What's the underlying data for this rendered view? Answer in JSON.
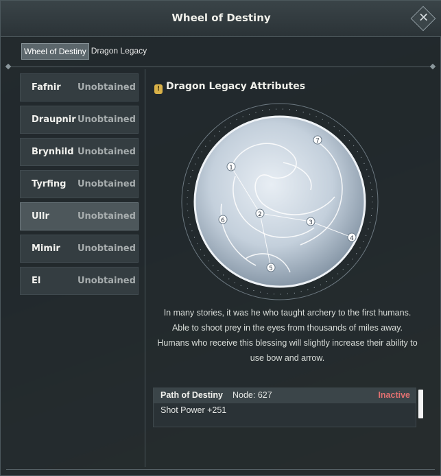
{
  "window": {
    "title": "Wheel of Destiny"
  },
  "tabs": [
    {
      "label": "Wheel of Destiny",
      "active": true
    },
    {
      "label": "Dragon Legacy",
      "active": false
    }
  ],
  "legacies": [
    {
      "name": "Fafnir",
      "status": "Unobtained",
      "selected": false
    },
    {
      "name": "Draupnir",
      "status": "Unobtained",
      "selected": false
    },
    {
      "name": "Brynhild",
      "status": "Unobtained",
      "selected": false
    },
    {
      "name": "Tyrfing",
      "status": "Unobtained",
      "selected": false
    },
    {
      "name": "Ullr",
      "status": "Unobtained",
      "selected": true
    },
    {
      "name": "Mimir",
      "status": "Unobtained",
      "selected": false
    },
    {
      "name": "El",
      "status": "Unobtained",
      "selected": false
    }
  ],
  "section": {
    "title": "Dragon Legacy Attributes",
    "icon": "info-icon",
    "icon_glyph": "!"
  },
  "wheel": {
    "node_labels": [
      "1",
      "2",
      "3",
      "4",
      "5",
      "6",
      "7"
    ]
  },
  "description": [
    "In many stories, it was he who taught archery to the first humans.",
    "Able to shoot prey in the eyes from thousands of miles away.",
    "Humans who receive this blessing will slightly increase their ability to use bow and arrow."
  ],
  "path": {
    "title": "Path of Destiny",
    "node": "Node: 627",
    "status": "Inactive",
    "effect": "Shot Power +251"
  },
  "colors": {
    "accent_status": "#e07070",
    "icon_gold": "#d9b148"
  }
}
